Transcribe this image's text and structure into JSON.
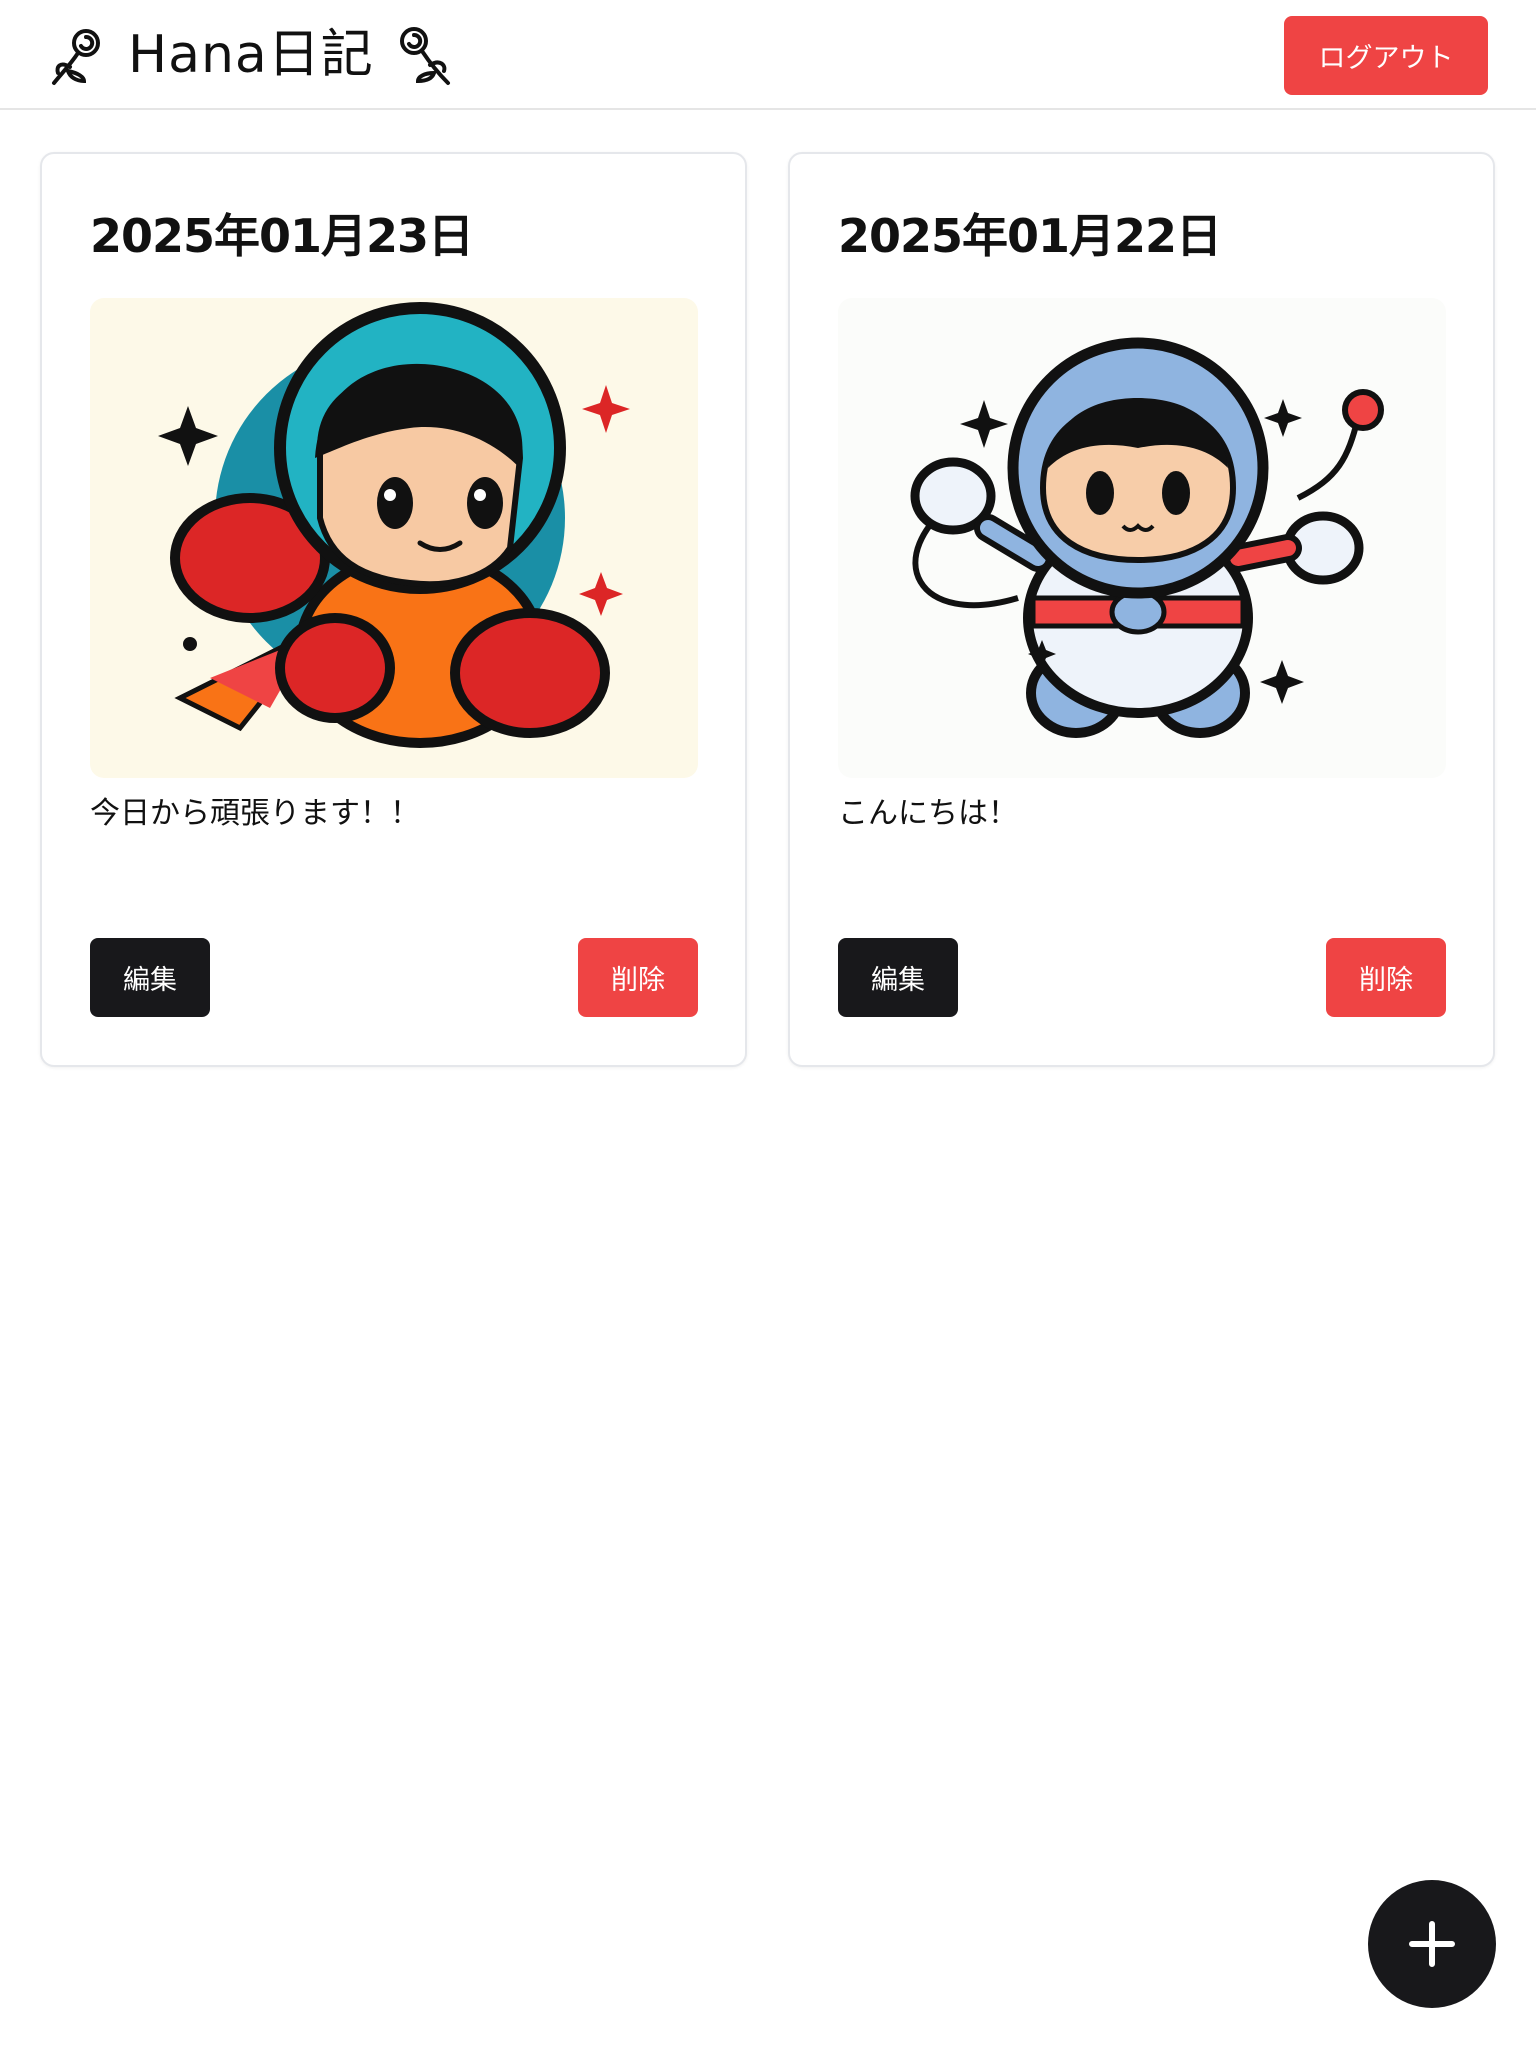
{
  "header": {
    "title": "Hana日記",
    "logout_label": "ログアウト"
  },
  "entries": [
    {
      "date": "2025年01月23日",
      "text": "今日から頑張ります！！",
      "edit_label": "編集",
      "delete_label": "削除"
    },
    {
      "date": "2025年01月22日",
      "text": "こんにちは！",
      "edit_label": "編集",
      "delete_label": "削除"
    }
  ],
  "fab": {
    "icon": "plus-icon"
  },
  "colors": {
    "danger": "#ef4444",
    "dark": "#18181b",
    "border": "#e5e7eb"
  }
}
